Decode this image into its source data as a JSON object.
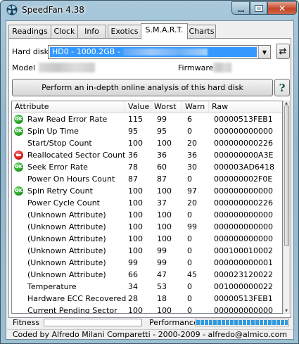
{
  "window": {
    "title": "SpeedFan 4.38",
    "close_glyph": "✕"
  },
  "tabs": [
    {
      "label": "Readings",
      "active": false
    },
    {
      "label": "Clock",
      "active": false
    },
    {
      "label": "Info",
      "active": false
    },
    {
      "label": "Exotics",
      "active": false
    },
    {
      "label": "S.M.A.R.T.",
      "active": true
    },
    {
      "label": "Charts",
      "active": false
    }
  ],
  "smart": {
    "hard_disk_label": "Hard disk",
    "hard_disk_value": "HD0 - 1000.2GB -",
    "model_label": "Model",
    "firmware_label": "Firmware",
    "online_analysis_button": "Perform an in-depth online analysis of this hard disk",
    "help_button": "?",
    "columns": [
      "Attribute",
      "Value",
      "Worst",
      "Warn",
      "Raw"
    ],
    "rows": [
      {
        "status": "ok",
        "attribute": "Raw Read Error Rate",
        "value": "115",
        "worst": "99",
        "warn": "6",
        "raw": "00000513FEB1"
      },
      {
        "status": "ok",
        "attribute": "Spin Up Time",
        "value": "95",
        "worst": "95",
        "warn": "0",
        "raw": "000000000000"
      },
      {
        "status": "none",
        "attribute": "Start/Stop Count",
        "value": "100",
        "worst": "100",
        "warn": "20",
        "raw": "000000000226"
      },
      {
        "status": "error",
        "attribute": "Reallocated Sector Count",
        "value": "36",
        "worst": "36",
        "warn": "36",
        "raw": "000000000A3E"
      },
      {
        "status": "ok",
        "attribute": "Seek Error Rate",
        "value": "78",
        "worst": "60",
        "warn": "30",
        "raw": "000003AD6418"
      },
      {
        "status": "none",
        "attribute": "Power On Hours Count",
        "value": "87",
        "worst": "87",
        "warn": "0",
        "raw": "000000002F0E"
      },
      {
        "status": "ok",
        "attribute": "Spin Retry Count",
        "value": "100",
        "worst": "100",
        "warn": "97",
        "raw": "000000000000"
      },
      {
        "status": "none",
        "attribute": "Power Cycle Count",
        "value": "100",
        "worst": "37",
        "warn": "20",
        "raw": "000000000226"
      },
      {
        "status": "none",
        "attribute": "(Unknown Attribute)",
        "value": "100",
        "worst": "100",
        "warn": "0",
        "raw": "000000000000"
      },
      {
        "status": "none",
        "attribute": "(Unknown Attribute)",
        "value": "100",
        "worst": "100",
        "warn": "99",
        "raw": "000000000000"
      },
      {
        "status": "none",
        "attribute": "(Unknown Attribute)",
        "value": "100",
        "worst": "100",
        "warn": "0",
        "raw": "000000000000"
      },
      {
        "status": "none",
        "attribute": "(Unknown Attribute)",
        "value": "100",
        "worst": "99",
        "warn": "0",
        "raw": "000100010002"
      },
      {
        "status": "none",
        "attribute": "(Unknown Attribute)",
        "value": "99",
        "worst": "99",
        "warn": "0",
        "raw": "000000000001"
      },
      {
        "status": "none",
        "attribute": "(Unknown Attribute)",
        "value": "66",
        "worst": "47",
        "warn": "45",
        "raw": "000023120022"
      },
      {
        "status": "none",
        "attribute": "Temperature",
        "value": "34",
        "worst": "53",
        "warn": "0",
        "raw": "001000000022"
      },
      {
        "status": "none",
        "attribute": "Hardware ECC Recovered",
        "value": "28",
        "worst": "18",
        "warn": "0",
        "raw": "00000513FEB1"
      },
      {
        "status": "none",
        "attribute": "Current Pending Sector",
        "value": "100",
        "worst": "100",
        "warn": "0",
        "raw": "000000000000"
      }
    ],
    "ok_badge": "OK",
    "fitness_label": "Fitness",
    "fitness_level": 0,
    "performance_label": "Performance",
    "performance_level": 1.0,
    "colors": {
      "ok": "#1a9a1a",
      "error": "#d11212",
      "selection": "#3399ff",
      "performance": "#3399dd"
    }
  },
  "footer": {
    "credit": "Coded by Alfredo Milani Comparetti - 2000-2009 - alfredo@almico.com"
  },
  "icons": {
    "app": "speedfan-fan-icon",
    "refresh": "refresh-icon",
    "minimize": "minimize-icon",
    "maximize": "maximize-icon",
    "close": "close-icon",
    "dropdown": "chevron-down-icon"
  }
}
